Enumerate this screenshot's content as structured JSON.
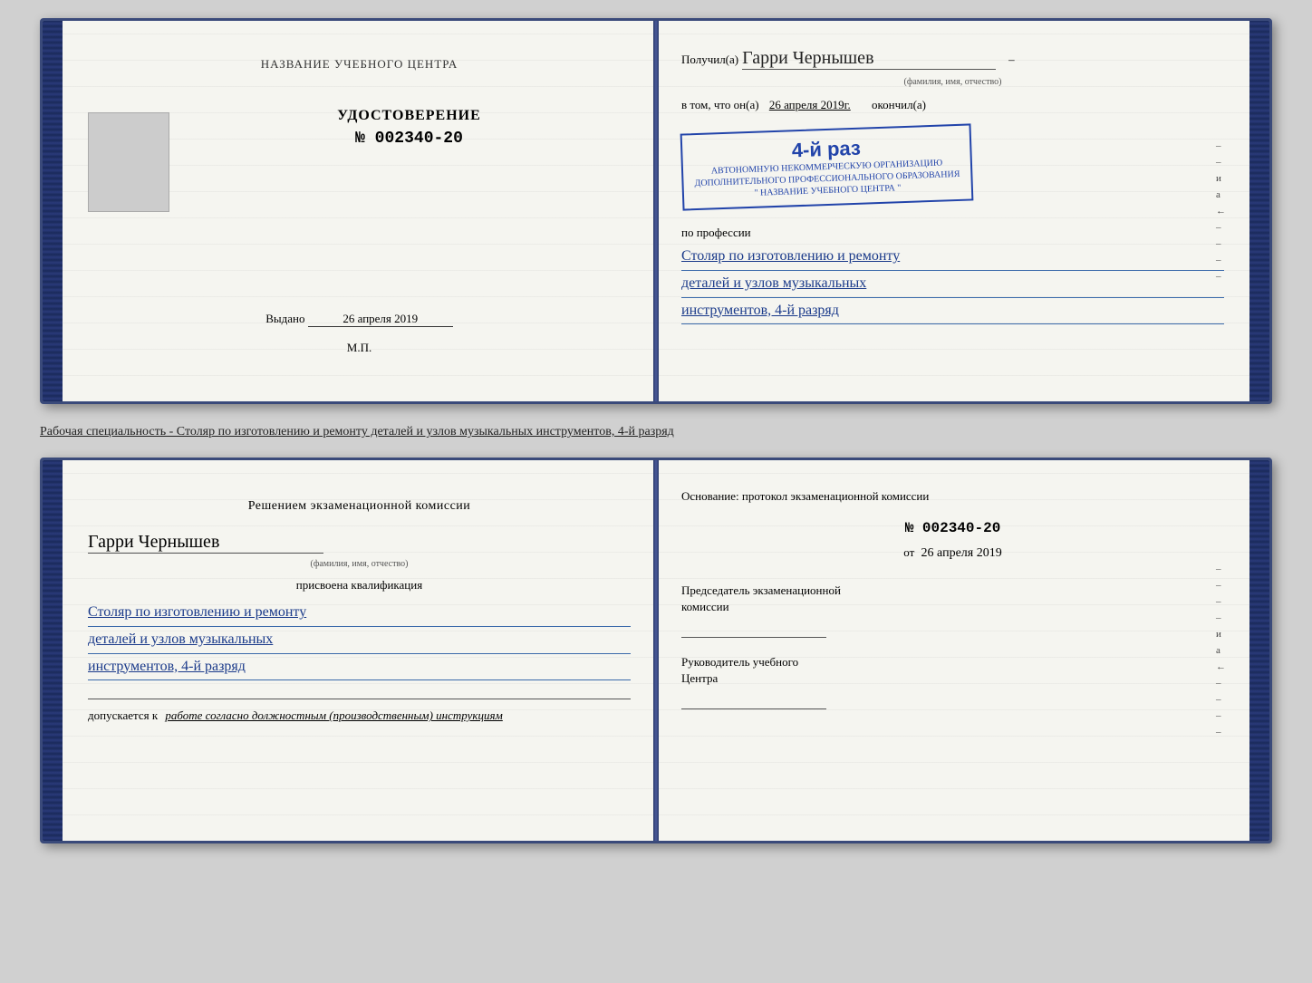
{
  "page": {
    "background_color": "#d0d0d0"
  },
  "doc1": {
    "left_page": {
      "institution_name": "НАЗВАНИЕ УЧЕБНОГО ЦЕНТРА",
      "photo_alt": "Фото",
      "cert_label": "УДОСТОВЕРЕНИЕ",
      "cert_number": "№ 002340-20",
      "issued_label": "Выдано",
      "issued_date": "26 апреля 2019",
      "mp_label": "М.П."
    },
    "right_page": {
      "received_prefix": "Получил(а)",
      "recipient_name": "Гарри Чернышев",
      "fio_label": "(фамилия, имя, отчество)",
      "vtom_prefix": "в том, что он(а)",
      "vtom_date": "26 апреля 2019г.",
      "okoncil": "окончил(а)",
      "stamp_big": "4-й раз",
      "stamp_line1": "АВТОНОМНУЮ НЕКОММЕРЧЕСКУЮ ОРГАНИЗАЦИЮ",
      "stamp_line2": "ДОПОЛНИТЕЛЬНОГО ПРОФЕССИОНАЛЬНОГО ОБРАЗОВАНИЯ",
      "stamp_line3": "\" НАЗВАНИЕ УЧЕБНОГО ЦЕНТРА \"",
      "po_professii": "по профессии",
      "profession_line1": "Столяр по изготовлению и ремонту",
      "profession_line2": "деталей и узлов музыкальных",
      "profession_line3": "инструментов, 4-й разряд",
      "side_letters": [
        "–",
        "–",
        "и",
        "а",
        "←",
        "–",
        "–",
        "–",
        "–"
      ]
    }
  },
  "caption": {
    "text": "Рабочая специальность - Столяр по изготовлению и ремонту деталей и узлов музыкальных инструментов, 4-й разряд"
  },
  "doc2": {
    "left_page": {
      "section_title": "Решением  экзаменационной  комиссии",
      "person_name": "Гарри Чернышев",
      "fio_label": "(фамилия, имя, отчество)",
      "assigned_text": "присвоена квалификация",
      "qualification_line1": "Столяр по изготовлению и ремонту",
      "qualification_line2": "деталей и узлов музыкальных",
      "qualification_line3": "инструментов, 4-й разряд",
      "allowed_prefix": "допускается к",
      "allowed_italic": "работе согласно должностным (производственным) инструкциям"
    },
    "right_page": {
      "basis_text": "Основание: протокол экзаменационной  комиссии",
      "protocol_number": "№  002340-20",
      "protocol_date_prefix": "от",
      "protocol_date": "26 апреля 2019",
      "chairman_title_line1": "Председатель экзаменационной",
      "chairman_title_line2": "комиссии",
      "head_title_line1": "Руководитель учебного",
      "head_title_line2": "Центра",
      "side_letters": [
        "–",
        "–",
        "–",
        "–",
        "и",
        "а",
        "←",
        "–",
        "–",
        "–",
        "–"
      ]
    }
  }
}
